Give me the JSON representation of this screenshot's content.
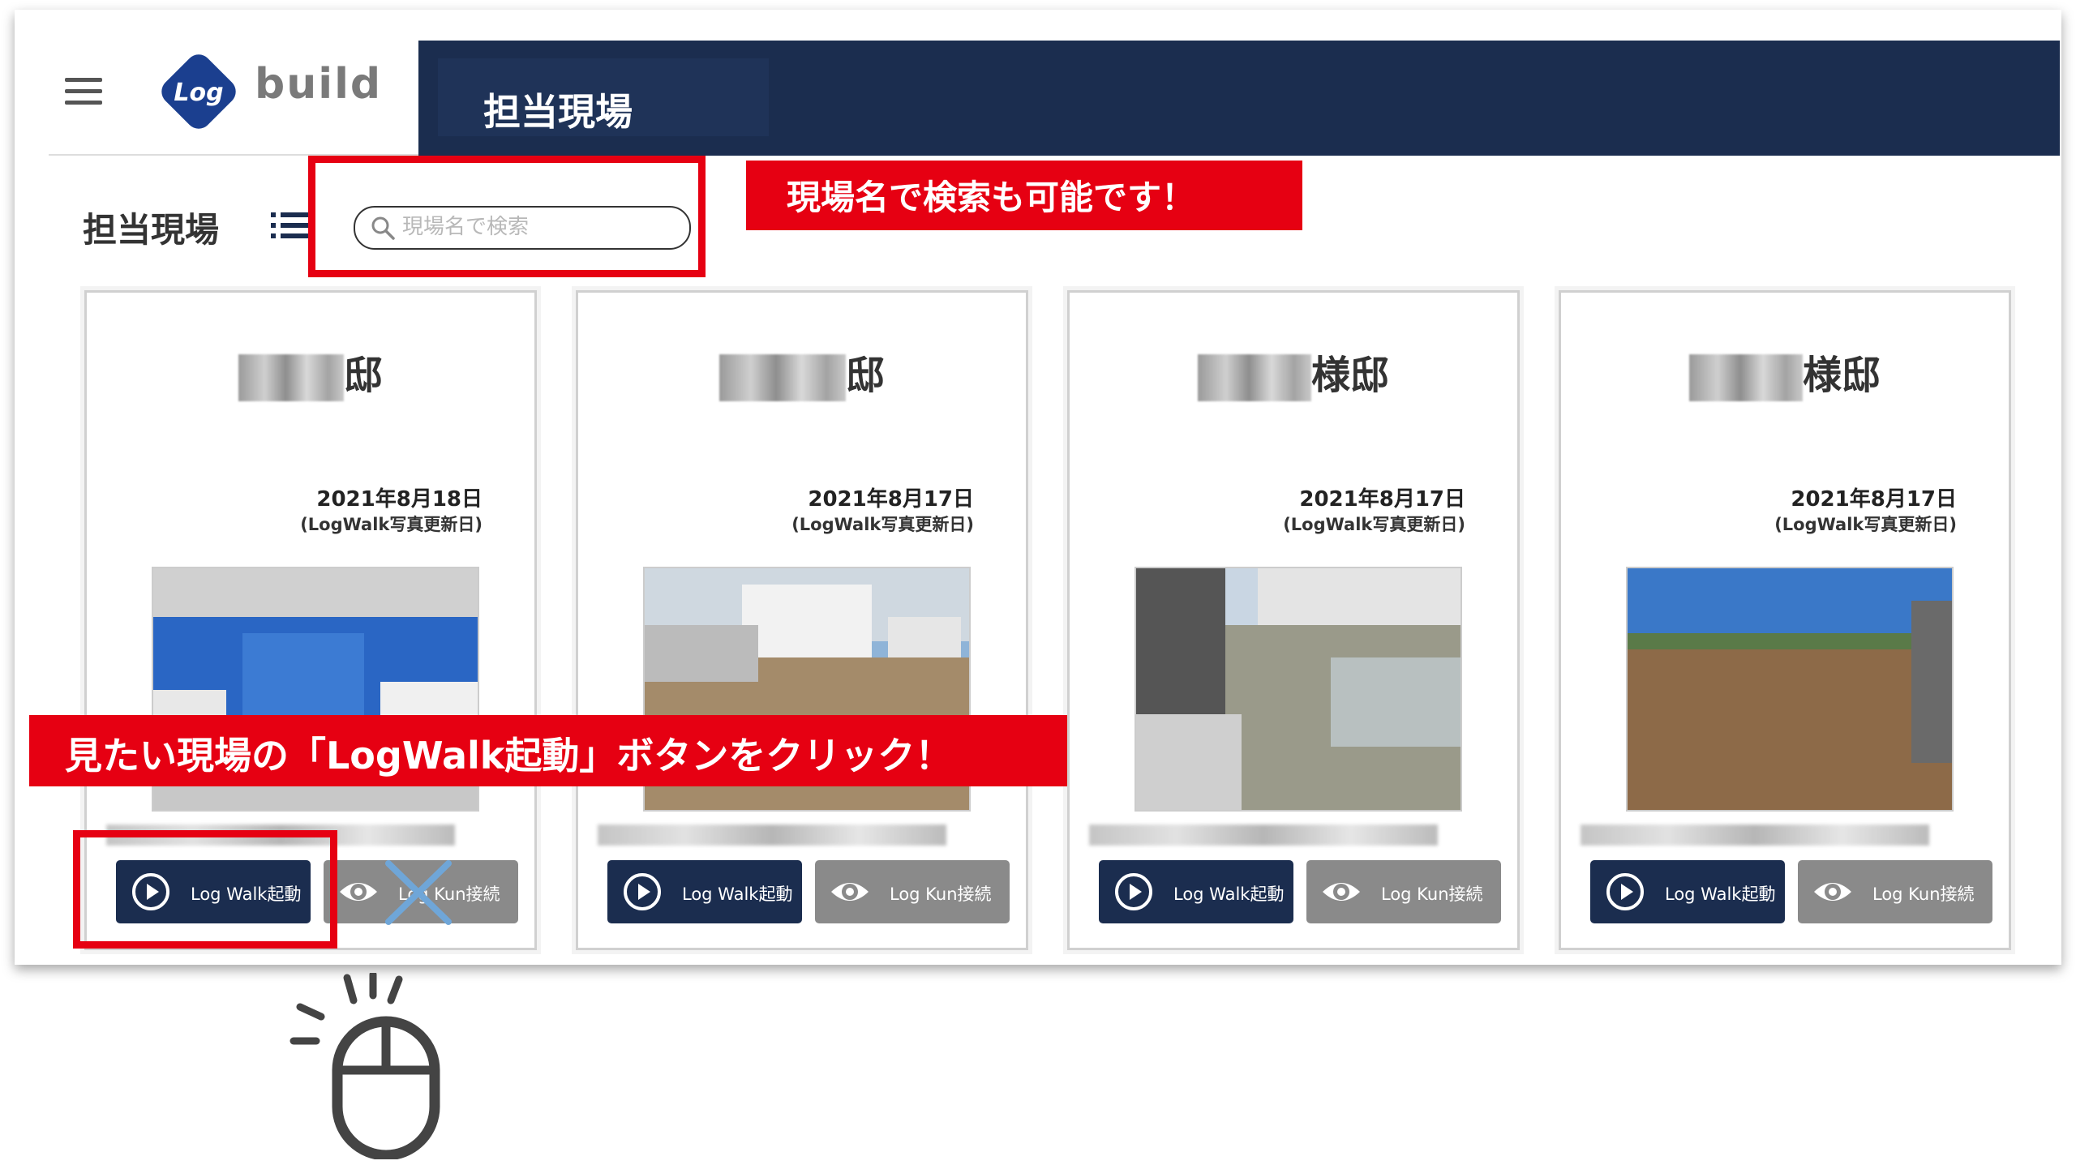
{
  "app": {
    "logo_word": "build",
    "logo_mark": "Log"
  },
  "header": {
    "title": "担当現場"
  },
  "toolbar": {
    "page_title": "担当現場",
    "search_placeholder": "現場名で検索"
  },
  "annotations": {
    "search_callout": "現場名で検索も可能です！",
    "click_callout": "見たい現場の「LogWalk起動」ボタンをクリック！"
  },
  "cards": [
    {
      "name_suffix": "邸",
      "date": "2021年8月18日",
      "date_note": "(LogWalk写真更新日)",
      "walk_label": "Log Walk起動",
      "kun_label": "Log Kun接続",
      "kun_disabled": true
    },
    {
      "name_suffix": "邸",
      "date": "2021年8月17日",
      "date_note": "(LogWalk写真更新日)",
      "walk_label": "Log Walk起動",
      "kun_label": "Log Kun接続",
      "kun_disabled": false
    },
    {
      "name_suffix": "様邸",
      "date": "2021年8月17日",
      "date_note": "(LogWalk写真更新日)",
      "walk_label": "Log Walk起動",
      "kun_label": "Log Kun接続",
      "kun_disabled": false
    },
    {
      "name_suffix": "様邸",
      "date": "2021年8月17日",
      "date_note": "(LogWalk写真更新日)",
      "walk_label": "Log Walk起動",
      "kun_label": "Log Kun接続",
      "kun_disabled": false
    }
  ],
  "colors": {
    "navy": "#1b2d4f",
    "annotation_red": "#e60012",
    "kun_gray": "#8a8a8a"
  },
  "icons": [
    "menu-icon",
    "list-icon",
    "search-icon",
    "play-icon",
    "eye-icon",
    "mouse-click-icon"
  ]
}
